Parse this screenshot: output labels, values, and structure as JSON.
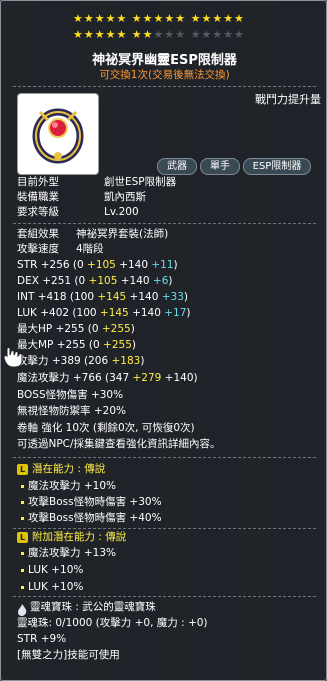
{
  "stars": {
    "row1": "★★★★★ ★★★★★ ★★★★★",
    "row2_filled": "★★★★★ ★★",
    "row2_empty": "★★★ ★★★★★"
  },
  "item": {
    "name": "神祕冥界幽靈ESP限制器",
    "trade_note": "可交換1次(交易後無法交換)",
    "power_label": "戰鬥力提升量",
    "tags": [
      "武器",
      "單手",
      "ESP限制器"
    ],
    "appearance_label": "目前外型",
    "appearance_value": "創世ESP限制器",
    "job_label": "裝備職業",
    "job_value": "凱內西斯",
    "level_label": "要求等級",
    "level_value": "Lv.200"
  },
  "stats": {
    "set_label": "套組效果",
    "set_value": "神祕冥界套裝(法師)",
    "speed_label": "攻擊速度",
    "speed_value": "4階段",
    "str_base": "STR  +256  (0 ",
    "str_a": "+105",
    "str_b": " +140 ",
    "str_c": "+11",
    "dex_base": "DEX  +251  (0 ",
    "dex_a": "+105",
    "dex_b": " +140 ",
    "dex_c": "+6",
    "int_base": "INT  +418  (100 ",
    "int_a": "+145",
    "int_b": " +140 ",
    "int_c": "+33",
    "luk_base": "LUK  +402  (100 ",
    "luk_a": "+145",
    "luk_b": " +140 ",
    "luk_c": "+17",
    "hp_base": "最大HP  +255  (0 ",
    "hp_a": "+255",
    "hp_end": ")",
    "mp_base": "最大MP  +255  (0 ",
    "mp_a": "+255",
    "mp_end": ")",
    "atk_base": "攻擊力  +389  (206 ",
    "atk_a": "+183",
    "atk_end": ")",
    "matk_base": "魔法攻擊力  +766  (347 ",
    "matk_a": "+279",
    "matk_b": " +140)",
    "boss": "BOSS怪物傷害  +30%",
    "ignore": "無視怪物防禦率  +20%",
    "scroll1": "卷軸 強化 10次 (剩餘0次, 可恢復0次)",
    "scroll2": "可透過NPC/採集鍵查看強化資訊詳細內容。"
  },
  "potential": {
    "title": "潛在能力 : 傳說",
    "badge": "L",
    "lines": [
      "魔法攻擊力 +10%",
      "攻擊Boss怪物時傷害 +30%",
      "攻擊Boss怪物時傷害 +40%"
    ]
  },
  "bonus": {
    "title": "附加潛在能力 : 傳說",
    "badge": "L",
    "lines": [
      "魔法攻擊力 +13%",
      "LUK +10%",
      "LUK +10%"
    ]
  },
  "soul": {
    "title": "靈魂寶珠 : 武公的靈魂寶珠",
    "value": "靈魂珠: 0/1000 (攻擊力 +0, 魔力 : +0)",
    "str": "STR +9%",
    "skill": "[無雙之力]技能可使用"
  },
  "colors": {
    "yellow": "#ffee44",
    "cyan": "#66ddee",
    "orange": "#ff9933"
  }
}
